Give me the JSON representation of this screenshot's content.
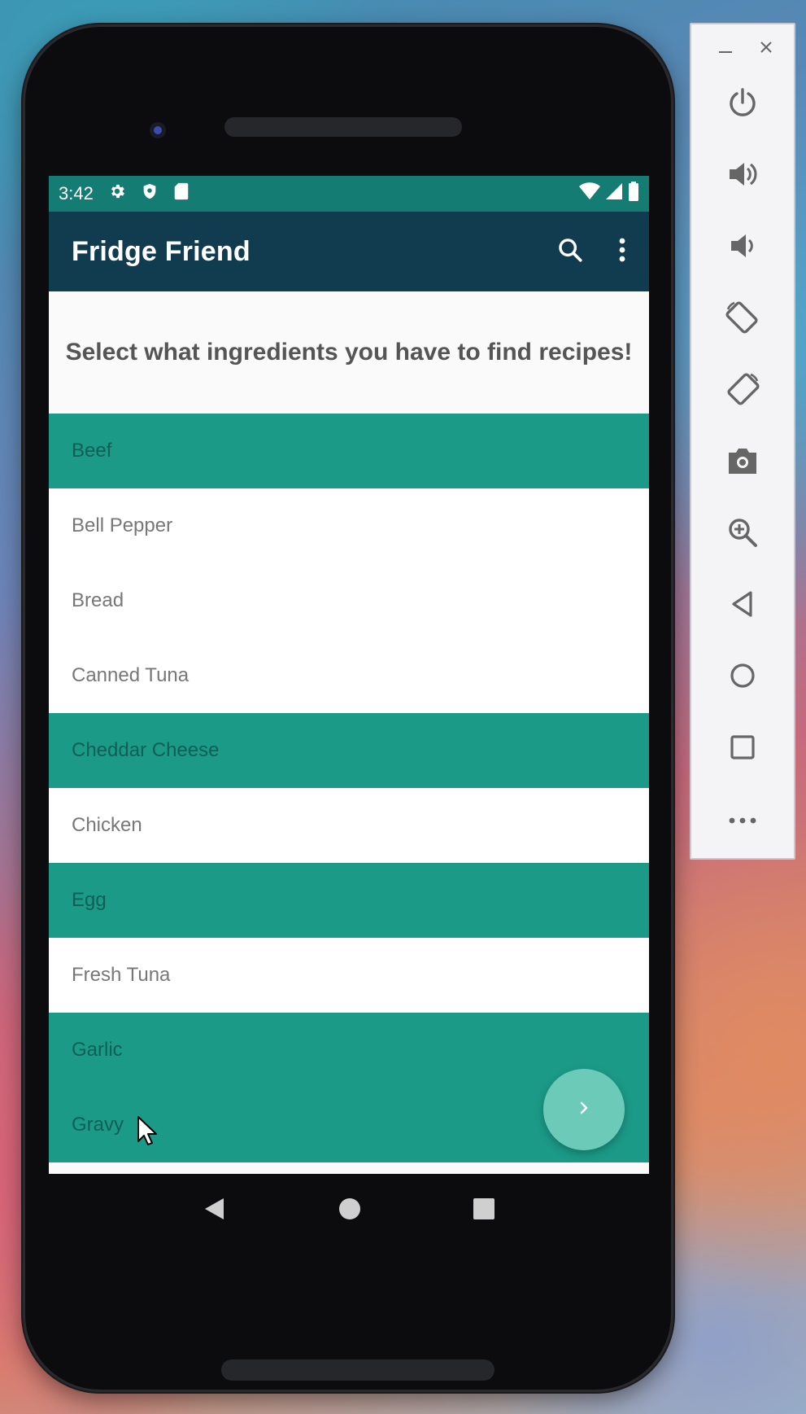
{
  "status_bar": {
    "time": "3:42",
    "icons_left": [
      "settings-icon",
      "shield-icon",
      "sd-card-icon"
    ],
    "icons_right": [
      "wifi-icon",
      "signal-icon",
      "battery-icon"
    ]
  },
  "toolbar": {
    "title": "Fridge Friend",
    "actions": [
      "search-icon",
      "more-vert-icon"
    ]
  },
  "heading": "Select what ingredients you have to find recipes!",
  "ingredients": [
    {
      "label": "Beef",
      "selected": true
    },
    {
      "label": "Bell Pepper",
      "selected": false
    },
    {
      "label": "Bread",
      "selected": false
    },
    {
      "label": "Canned Tuna",
      "selected": false
    },
    {
      "label": "Cheddar Cheese",
      "selected": true
    },
    {
      "label": "Chicken",
      "selected": false
    },
    {
      "label": "Egg",
      "selected": true
    },
    {
      "label": "Fresh Tuna",
      "selected": false
    },
    {
      "label": "Garlic",
      "selected": true
    },
    {
      "label": "Gravy",
      "selected": true
    }
  ],
  "fab": {
    "icon": "chevron-right-icon"
  },
  "nav": [
    "back-icon",
    "home-icon",
    "recents-icon"
  ],
  "emulator_panel": {
    "window_controls": [
      "minimize-icon",
      "close-icon"
    ],
    "buttons": [
      "power-icon",
      "volume-up-icon",
      "volume-down-icon",
      "rotate-left-icon",
      "rotate-right-icon",
      "camera-icon",
      "zoom-in-icon",
      "back-icon",
      "home-icon",
      "overview-icon",
      "more-icon"
    ]
  },
  "colors": {
    "status_bar": "#157c74",
    "toolbar": "#113c4f",
    "selected_row": "#1b9a87",
    "fab": "#6ccab8"
  }
}
